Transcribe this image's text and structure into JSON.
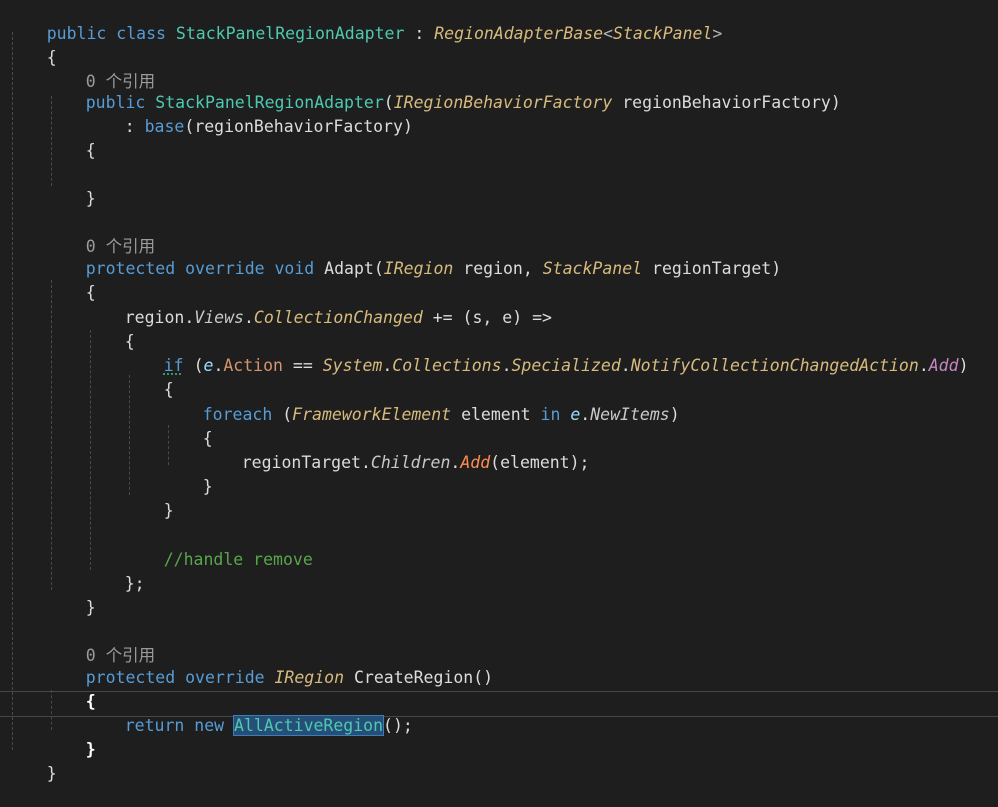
{
  "code": {
    "class_kw": "public class",
    "class_name": "StackPanelRegionAdapter",
    "colon": " : ",
    "base_type": "RegionAdapterBase",
    "base_generic": "StackPanel",
    "open_brace": "{",
    "close_brace": "}",
    "ref_lens_1": "0 个引用",
    "ref_lens_2": "0 个引用",
    "ref_lens_3": "0 个引用",
    "ctor_kw": "public",
    "ctor_name": "StackPanelRegionAdapter",
    "ctor_param_type": "IRegionBehaviorFactory",
    "ctor_param_name": "regionBehaviorFactory",
    "base_call_kw": "base",
    "base_call_arg": "regionBehaviorFactory",
    "adapt_modifiers": "protected override void",
    "adapt_name": "Adapt",
    "adapt_p1_type": "IRegion",
    "adapt_p1_name": "region",
    "adapt_p2_type": "StackPanel",
    "adapt_p2_name": "regionTarget",
    "region_obj": "region",
    "views_prop": "Views",
    "collection_changed": "CollectionChanged",
    "lambda_head": " += (s, e) =>",
    "if_kw": "if",
    "e_param": "e",
    "action_prop": "Action",
    "eq_op": " == ",
    "ns_system": "System",
    "ns_collections": "Collections",
    "ns_specialized": "Specialized",
    "enum_type": "NotifyCollectionChangedAction",
    "enum_member": "Add",
    "foreach_kw": "foreach",
    "foreach_type": "FrameworkElement",
    "foreach_var": "element",
    "in_kw": "in",
    "new_items": "NewItems",
    "region_target": "regionTarget",
    "children_prop": "Children",
    "add_method": "Add",
    "add_arg": "element",
    "comment": "//handle remove",
    "lambda_end": "};",
    "create_modifiers": "protected override",
    "create_return": "IRegion",
    "create_name": "CreateRegion",
    "return_kw": "return new",
    "return_type": "AllActiveRegion",
    "return_end": "();"
  }
}
